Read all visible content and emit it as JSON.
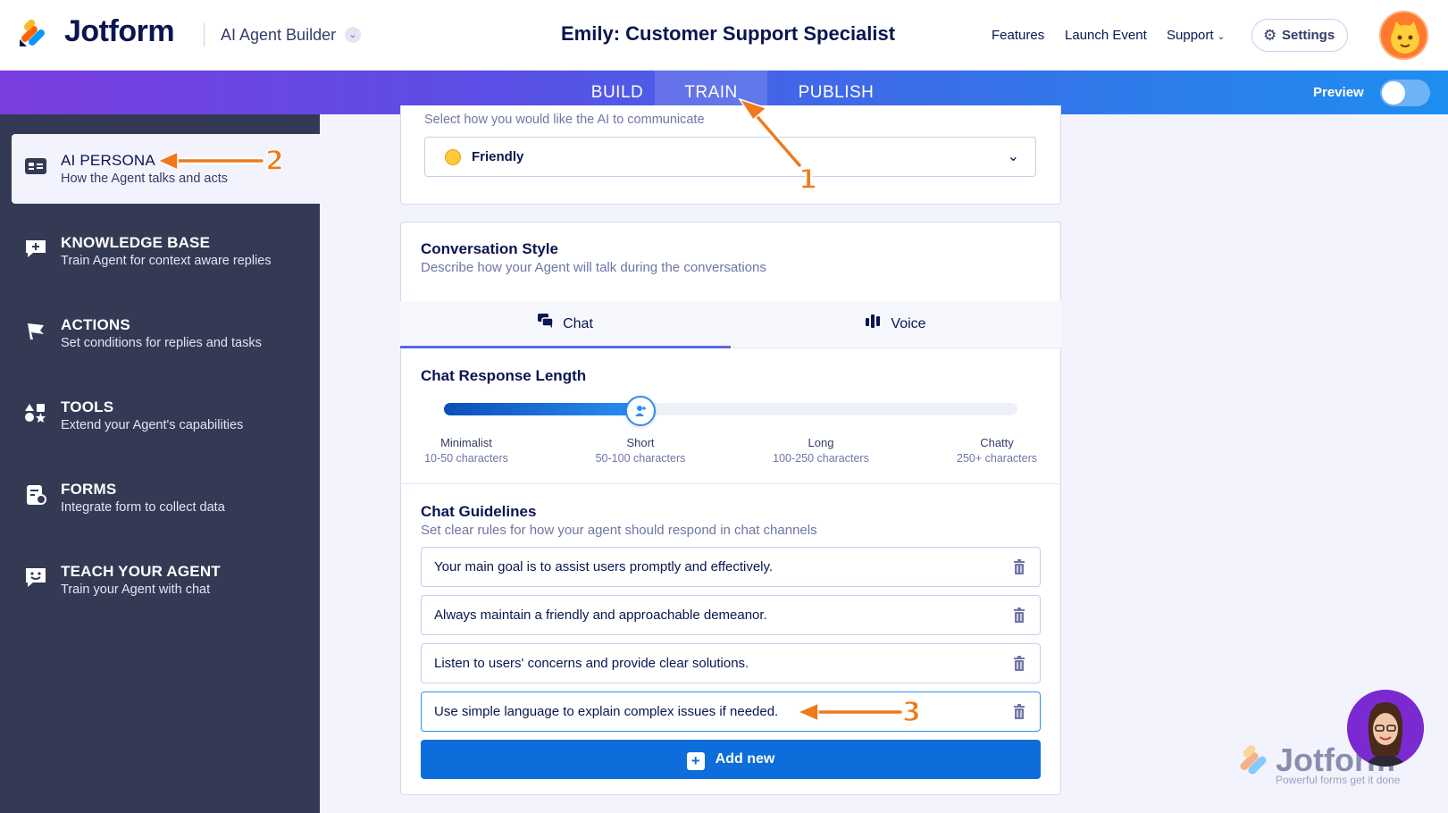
{
  "header": {
    "logo_text": "Jotform",
    "product": "AI Agent Builder",
    "agent_title": "Emily: Customer Support Specialist",
    "nav": [
      "Features",
      "Launch Event",
      "Support"
    ],
    "settings_label": "Settings"
  },
  "tabs": {
    "build": "BUILD",
    "train": "TRAIN",
    "publish": "PUBLISH",
    "preview_label": "Preview"
  },
  "sidebar": {
    "items": [
      {
        "title": "AI PERSONA",
        "sub": "How the Agent talks and acts"
      },
      {
        "title": "KNOWLEDGE BASE",
        "sub": "Train Agent for context aware replies"
      },
      {
        "title": "ACTIONS",
        "sub": "Set conditions for replies and tasks"
      },
      {
        "title": "TOOLS",
        "sub": "Extend your Agent's capabilities"
      },
      {
        "title": "FORMS",
        "sub": "Integrate form to collect data"
      },
      {
        "title": "TEACH YOUR AGENT",
        "sub": "Train your Agent with chat"
      }
    ]
  },
  "tone": {
    "subtitle": "Select how you would like the AI to communicate",
    "selected": "Friendly"
  },
  "conversation": {
    "title": "Conversation Style",
    "subtitle": "Describe how your Agent will talk during the conversations",
    "tab_chat": "Chat",
    "tab_voice": "Voice"
  },
  "response_length": {
    "title": "Chat Response Length",
    "selected_index": 1,
    "options": [
      {
        "label": "Minimalist",
        "sub": "10-50 characters"
      },
      {
        "label": "Short",
        "sub": "50-100 characters"
      },
      {
        "label": "Long",
        "sub": "100-250 characters"
      },
      {
        "label": "Chatty",
        "sub": "250+ characters"
      }
    ]
  },
  "guidelines": {
    "title": "Chat Guidelines",
    "subtitle": "Set clear rules for how your agent should respond in chat channels",
    "items": [
      "Your main goal is to assist users promptly and effectively.",
      "Always maintain a friendly and approachable demeanor.",
      "Listen to users' concerns and provide clear solutions.",
      "Use simple language to explain complex issues if needed."
    ],
    "add_label": "Add new"
  },
  "annotations": [
    "1",
    "2",
    "3"
  ],
  "watermark": {
    "logo": "Jotform",
    "tagline": "Powerful forms get it done"
  },
  "colors": {
    "sidebar": "#343a54",
    "primary_button": "#0d6ddb",
    "annotation": "#ef7a1a",
    "slider_fill": "#2b8ef3"
  }
}
